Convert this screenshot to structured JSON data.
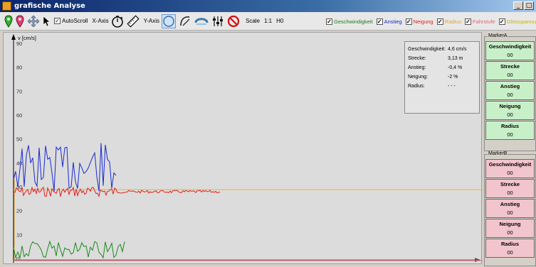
{
  "window": {
    "title": "grafische Analyse",
    "minimize_label": "_",
    "maximize_label": "□"
  },
  "toolbar": {
    "autoscroll_label": "AutoScroll",
    "autoscroll_checked": true,
    "xaxis_label": "X-Axis",
    "yaxis_label": "Y-Axis",
    "scale_label": "Scale",
    "scale_value": "1:1",
    "h0_label": "H0",
    "checkmark": "✓"
  },
  "legend": [
    {
      "label": "Geschwindigkeit",
      "color": "#1a7a1a",
      "checked": true
    },
    {
      "label": "Anstieg",
      "color": "#1a2ad0",
      "checked": true
    },
    {
      "label": "Neigung",
      "color": "#e02020",
      "checked": true
    },
    {
      "label": "Radius",
      "color": "#f0a020",
      "checked": true
    },
    {
      "label": "Fahrstufe",
      "color": "#f06070",
      "checked": true
    },
    {
      "label": "Gleisspannu",
      "color": "#d0c000",
      "checked": true
    }
  ],
  "plot": {
    "y_axis_title": "v [cm/s]",
    "y_ticks": [
      "90",
      "80",
      "70",
      "60",
      "50",
      "40",
      "30",
      "20",
      "10",
      "0"
    ]
  },
  "infobox": {
    "rows": [
      {
        "key": "Geschwindigkeit:",
        "value": "4,6 cm/s"
      },
      {
        "key": "Strecke:",
        "value": "3,13 m"
      },
      {
        "key": "Anstieg:",
        "value": "-0,4 %"
      },
      {
        "key": "Neigung:",
        "value": "-2 %"
      },
      {
        "key": "Radius:",
        "value": "- - -"
      }
    ]
  },
  "markerA": {
    "title": "MarkerA",
    "fields": [
      {
        "label": "Geschwindigkeit",
        "value": "00"
      },
      {
        "label": "Strecke",
        "value": "00"
      },
      {
        "label": "Anstieg",
        "value": "00"
      },
      {
        "label": "Neigung",
        "value": "00"
      },
      {
        "label": "Radius",
        "value": "00"
      }
    ]
  },
  "markerB": {
    "title": "MarkerB",
    "fields": [
      {
        "label": "Geschwindigkeit",
        "value": "00"
      },
      {
        "label": "Strecke",
        "value": "00"
      },
      {
        "label": "Anstieg",
        "value": "00"
      },
      {
        "label": "Neigung",
        "value": "00"
      },
      {
        "label": "Radius",
        "value": "00"
      }
    ]
  },
  "colors": {
    "series_blue": "#1a2ad0",
    "series_red": "#e02020",
    "series_green": "#1a8a1a",
    "series_orange": "#f0b040",
    "marker_a_bg": "#c8f0c8",
    "marker_b_bg": "#f2c4cc"
  }
}
